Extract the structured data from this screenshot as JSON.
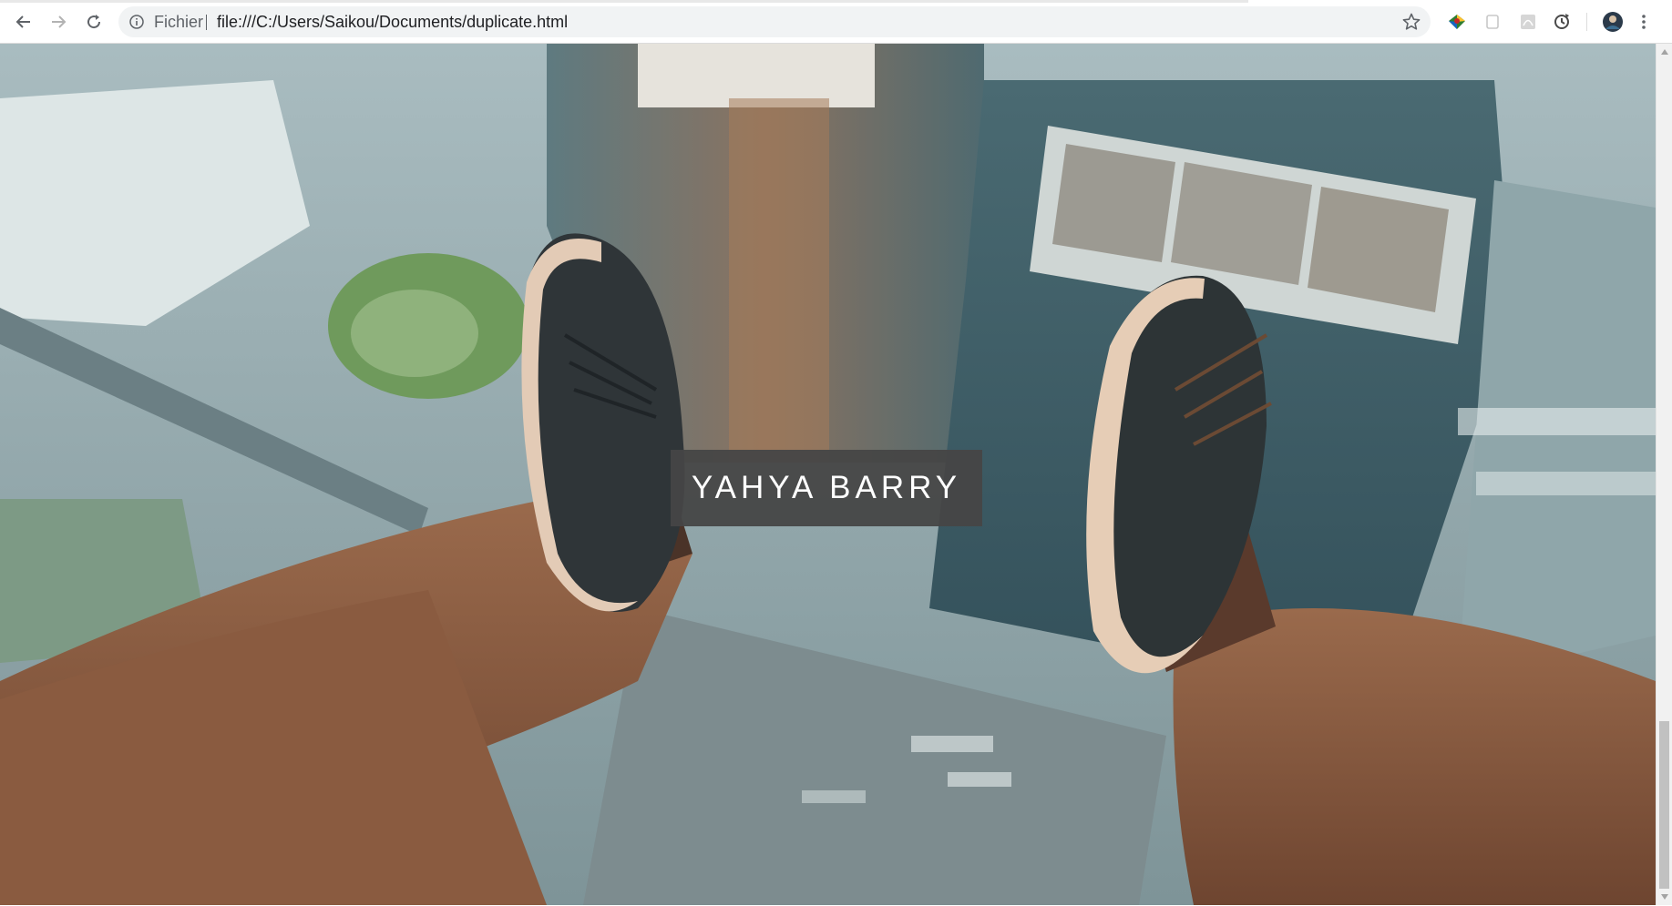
{
  "browser": {
    "back_icon": "arrow-left-icon",
    "forward_icon": "arrow-right-icon",
    "reload_icon": "reload-icon",
    "address": {
      "info_icon": "info-icon",
      "scheme_label": "Fichier",
      "url": "file:///C:/Users/Saikou/Documents/duplicate.html",
      "bookmark_icon": "star-icon"
    },
    "extensions": [
      "globe-extension-icon",
      "square-extension-icon",
      "pdf-extension-icon",
      "sync-extension-icon"
    ],
    "profile_icon": "avatar-icon",
    "menu_icon": "kebab-menu-icon"
  },
  "page": {
    "hero_title": "YAHYA BARRY",
    "hero_image": "feet-dangling-over-city-photo"
  },
  "colors": {
    "title_box_bg": "#464646",
    "title_text": "#ffffff",
    "toolbar_bg": "#ffffff",
    "omnibox_bg": "#f1f3f4"
  }
}
